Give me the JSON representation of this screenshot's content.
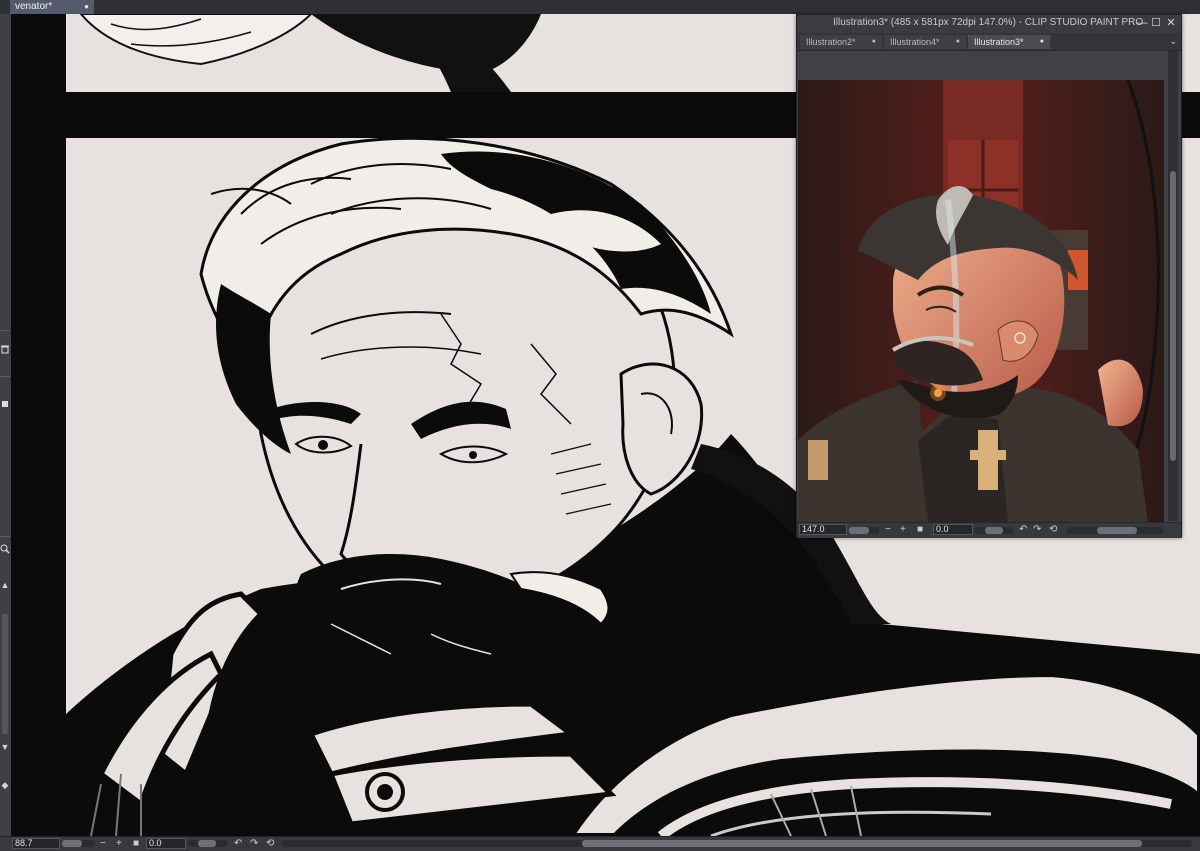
{
  "main_tab": {
    "label": "venator*"
  },
  "main_status": {
    "zoom": "88.7",
    "rotation": "0.0"
  },
  "sub_window": {
    "title": "Illustration3* (485 x 581px 72dpi 147.0%)  - CLIP STUDIO PAINT PRO",
    "tabs": [
      {
        "label": "Illustration2*"
      },
      {
        "label": "Illustration4*"
      },
      {
        "label": "Illustration3*"
      }
    ],
    "active_tab_index": 2,
    "zoom": "147.0",
    "rotation": "0.0"
  },
  "icons": {
    "close": "close-icon",
    "minimize": "minimize-icon",
    "maximize": "maximize-icon",
    "trash": "trash-icon",
    "magnifier": "magnifier-icon",
    "rotate_left": "rotate-left-icon",
    "rotate_right": "rotate-right-icon",
    "reset": "reset-icon",
    "zoom_in": "zoom-in-icon",
    "zoom_out": "zoom-out-icon"
  },
  "colors": {
    "panel": "#3a3b3f",
    "active_tab": "#535a6c",
    "paper": "#e7e2df",
    "ink": "#0a0a0a",
    "glow": "#ff9c3a"
  }
}
